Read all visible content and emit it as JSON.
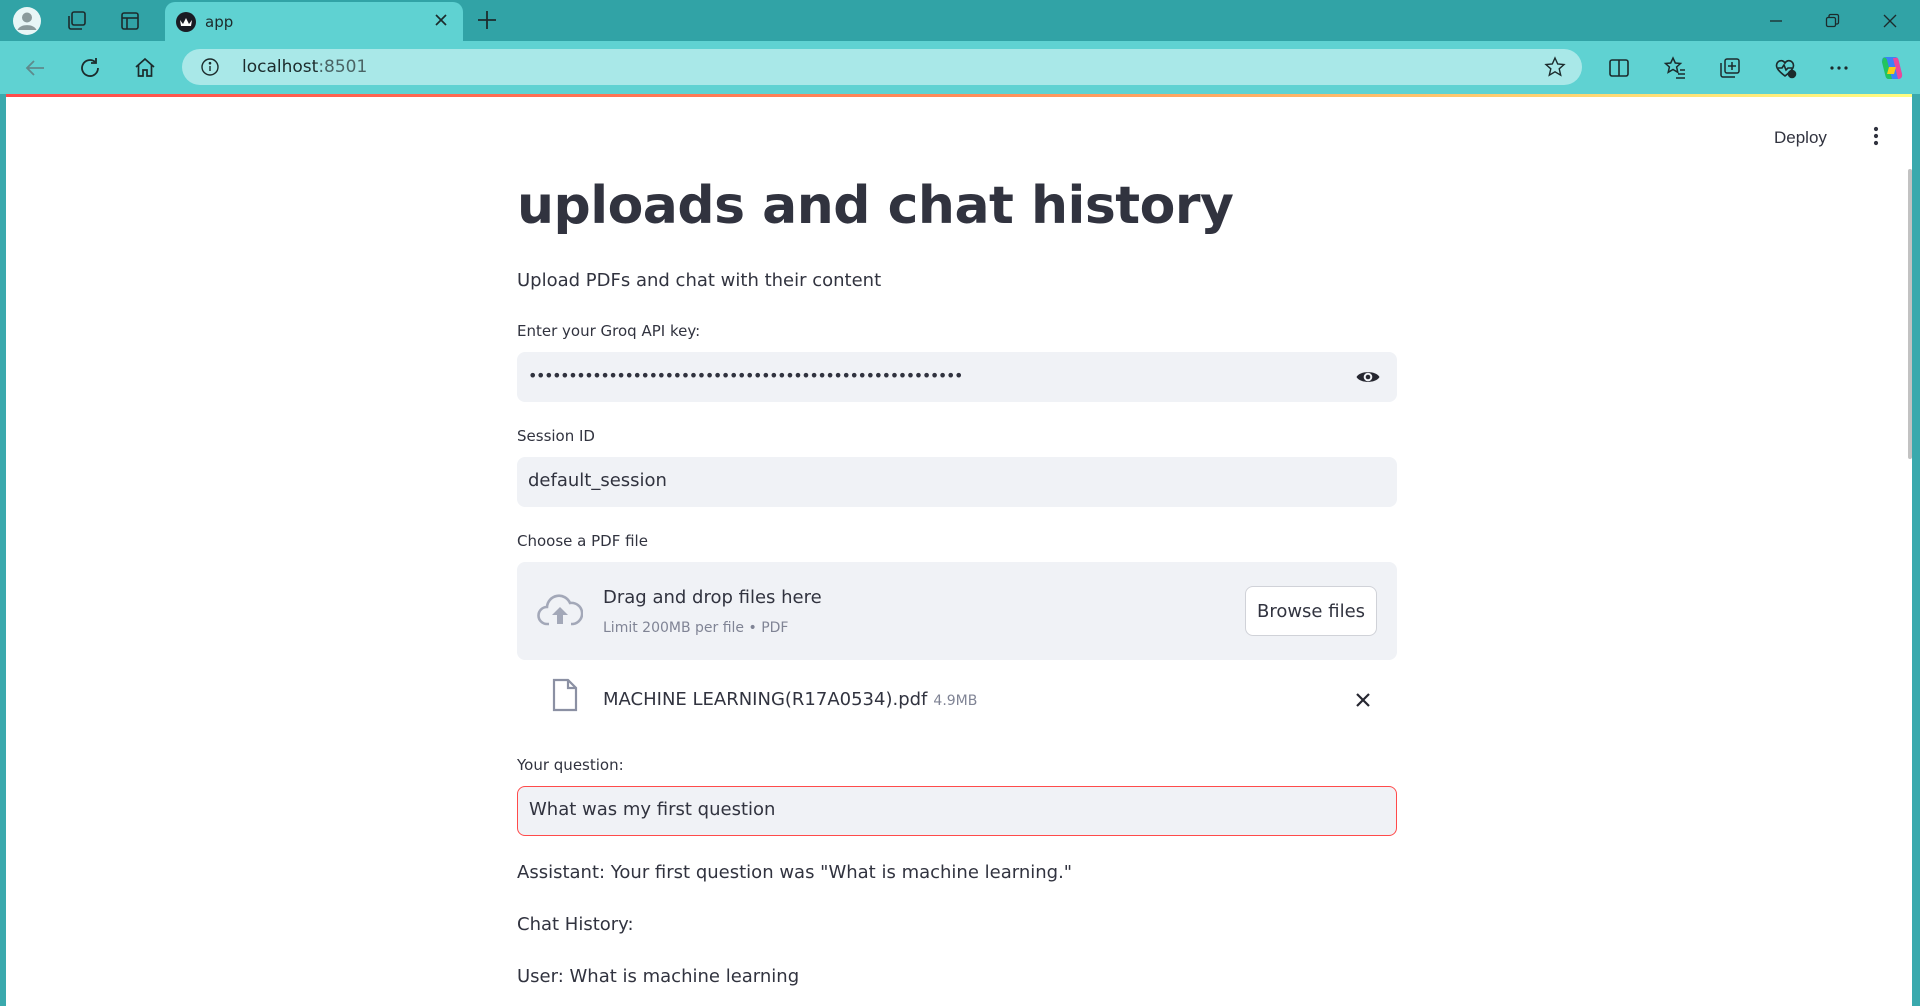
{
  "browser": {
    "tab_title": "app",
    "url_host": "localhost",
    "url_port": ":8501"
  },
  "header": {
    "deploy_label": "Deploy"
  },
  "main": {
    "title": "uploads and chat history",
    "subtitle": "Upload PDFs and chat with their content",
    "api_key": {
      "label": "Enter your Groq API key:",
      "masked_value": "••••••••••••••••••••••••••••••••••••••••••••••••••••••"
    },
    "session": {
      "label": "Session ID",
      "value": "default_session"
    },
    "uploader": {
      "label": "Choose a PDF file",
      "drop_title": "Drag and drop files here",
      "limit": "Limit 200MB per file • PDF",
      "browse_label": "Browse files",
      "file_name": "MACHINE LEARNING(R17A0534).pdf",
      "file_size": "4.9MB"
    },
    "question": {
      "label": "Your question:",
      "value": "What was my first question"
    },
    "answer": "Assistant: Your first question was \"What is machine learning.\"",
    "history_heading": "Chat History:",
    "history_first": "User: What is machine learning"
  },
  "colors": {
    "accent": "#ff4b4b",
    "browser_frame": "#5fd2d2",
    "field_bg": "#f0f2f6"
  },
  "icons": [
    "profile-icon",
    "workspaces-icon",
    "tab-actions-icon",
    "streamlit-favicon",
    "close-icon",
    "plus-icon",
    "minimize-icon",
    "restore-icon",
    "back-icon",
    "refresh-icon",
    "home-icon",
    "info-icon",
    "star-icon",
    "split-screen-icon",
    "favorites-icon",
    "collections-icon",
    "health-icon",
    "more-icon",
    "copilot-icon",
    "kebab-icon",
    "eye-icon",
    "cloud-upload-icon",
    "file-icon"
  ]
}
